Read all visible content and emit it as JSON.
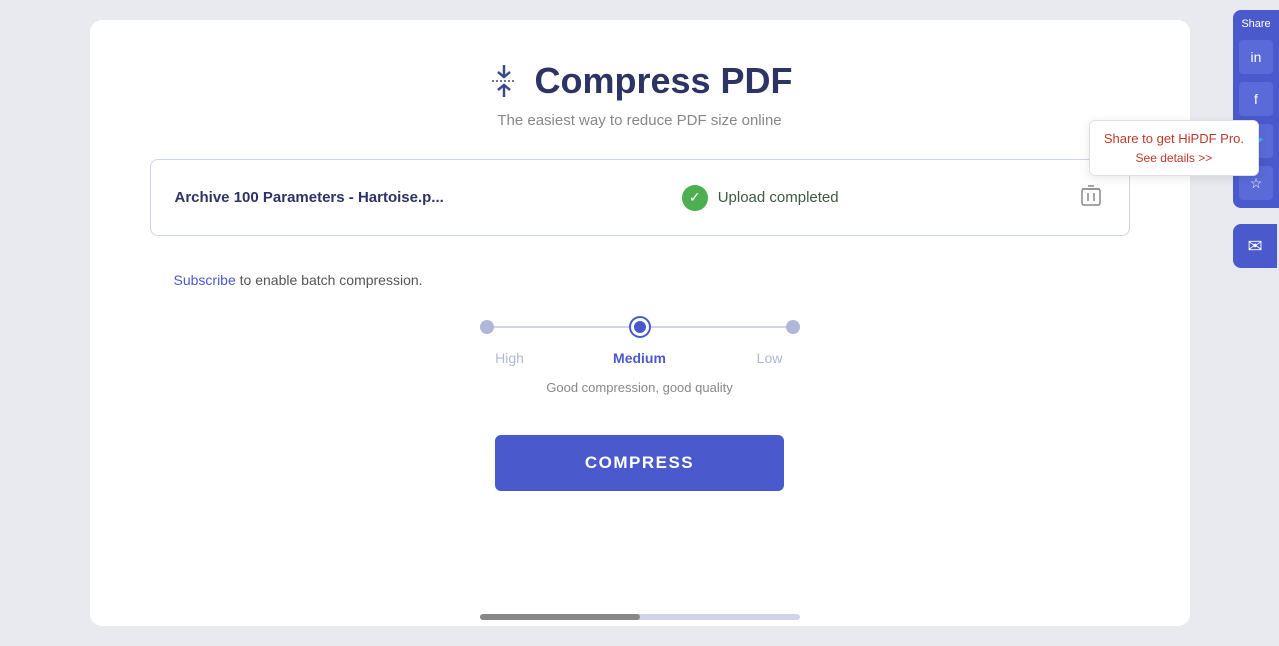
{
  "header": {
    "icon": "⊛",
    "title": "Compress PDF",
    "subtitle": "The easiest way to reduce PDF size online"
  },
  "share_promo": {
    "title": "Share to get HiPDF Pro.",
    "link_text": "See details >>"
  },
  "sidebar": {
    "share_label": "Share",
    "social_buttons": [
      {
        "name": "linkedin",
        "icon": "in"
      },
      {
        "name": "facebook",
        "icon": "f"
      },
      {
        "name": "twitter",
        "icon": "🐦"
      },
      {
        "name": "star",
        "icon": "☆"
      }
    ],
    "email_icon": "✉"
  },
  "file_upload": {
    "file_name": "Archive 100 Parameters - Hartoise.p...",
    "status": "Upload completed",
    "delete_label": "Delete"
  },
  "subscribe": {
    "link_text": "Subscribe",
    "description": " to enable batch compression."
  },
  "compression": {
    "levels": [
      {
        "id": "high",
        "label": "High",
        "active": false
      },
      {
        "id": "medium",
        "label": "Medium",
        "active": true
      },
      {
        "id": "low",
        "label": "Low",
        "active": false
      }
    ],
    "description": "Good compression, good quality"
  },
  "compress_button": {
    "label": "COMPRESS"
  }
}
